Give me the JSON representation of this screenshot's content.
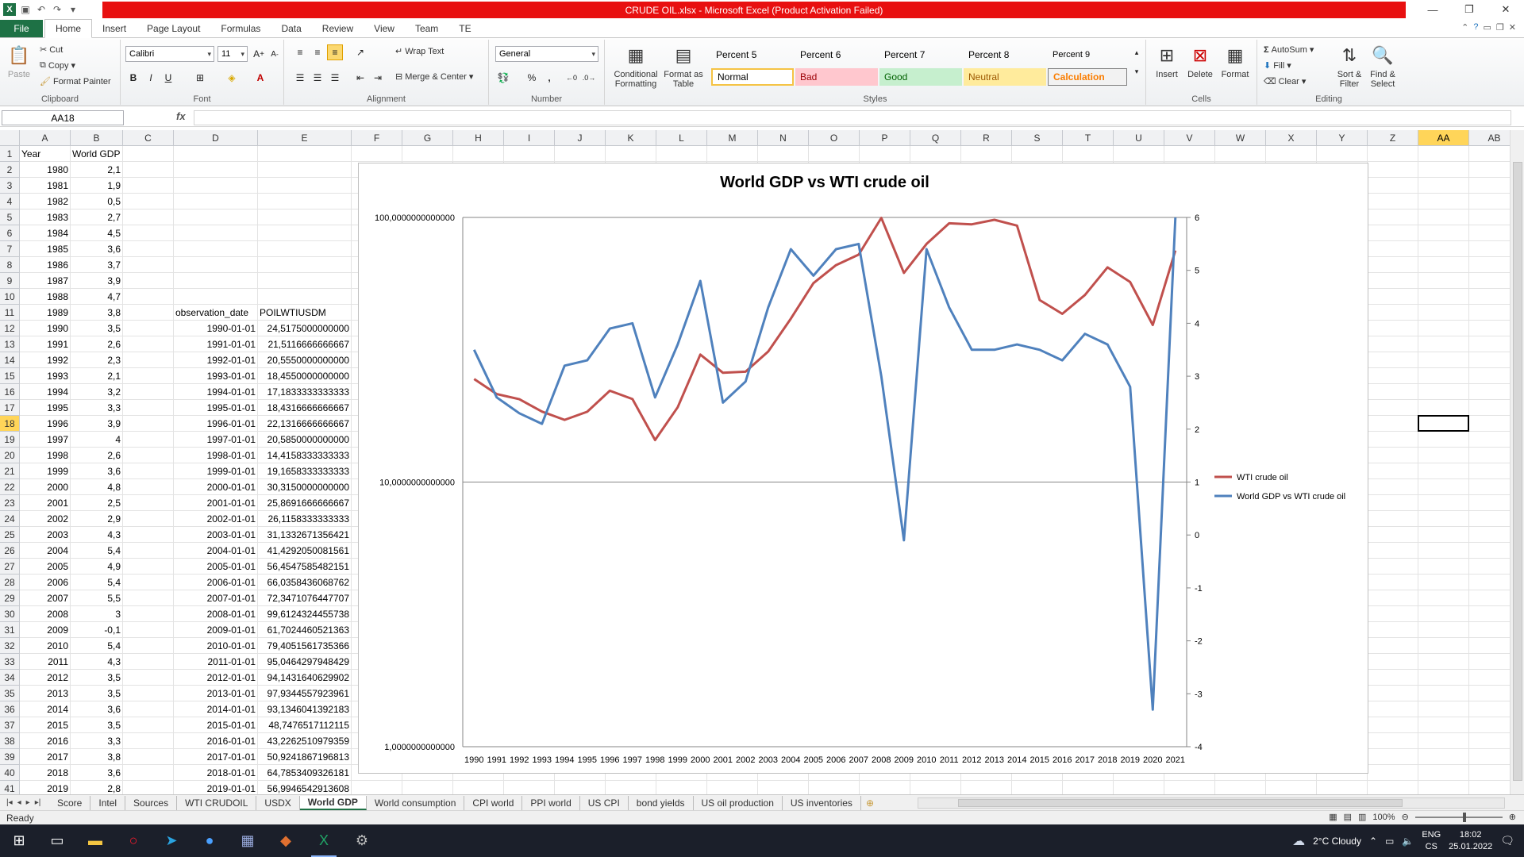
{
  "window": {
    "title": "CRUDE OIL.xlsx  -  Microsoft Excel (Product Activation Failed)",
    "controls": [
      "—",
      "❐",
      "✕"
    ]
  },
  "ribbon_tabs": [
    "File",
    "Home",
    "Insert",
    "Page Layout",
    "Formulas",
    "Data",
    "Review",
    "View",
    "Team",
    "TE"
  ],
  "ribbon": {
    "clipboard": {
      "paste": "Paste",
      "cut": "Cut",
      "copy": "Copy",
      "format_painter": "Format Painter",
      "label": "Clipboard"
    },
    "font": {
      "name": "Calibri",
      "size": "11",
      "bold": "B",
      "italic": "I",
      "underline": "U",
      "label": "Font"
    },
    "alignment": {
      "wrap_text": "Wrap Text",
      "merge_center": "Merge & Center",
      "label": "Alignment"
    },
    "number": {
      "format": "General",
      "percent": "%",
      "comma": ",",
      "label": "Number"
    },
    "styles": {
      "conditional_formatting": "Conditional Formatting",
      "format_as_table": "Format as Table",
      "cells_row1": [
        "Percent 5",
        "Percent 6",
        "Percent 7",
        "Percent 8",
        "Percent 9"
      ],
      "cells_row2": [
        "Normal",
        "Bad",
        "Good",
        "Neutral",
        "Calculation"
      ],
      "label": "Styles"
    },
    "cells": {
      "insert": "Insert",
      "delete": "Delete",
      "format": "Format",
      "label": "Cells"
    },
    "editing": {
      "autosum": "AutoSum",
      "fill": "Fill",
      "clear": "Clear",
      "sort_filter": "Sort & Filter",
      "find_select": "Find & Select",
      "label": "Editing"
    }
  },
  "formula_bar": {
    "name_box": "AA18",
    "fx": "fx",
    "formula": ""
  },
  "columns": [
    "A",
    "B",
    "C",
    "D",
    "E",
    "F",
    "G",
    "H",
    "I",
    "J",
    "K",
    "L",
    "M",
    "N",
    "O",
    "P",
    "Q",
    "R",
    "S",
    "T",
    "U",
    "V",
    "W",
    "X",
    "Y",
    "Z",
    "AA",
    "AB"
  ],
  "selected_column": "AA",
  "selected_row": 18,
  "rows": [
    "1",
    "2",
    "3",
    "4",
    "5",
    "6",
    "7",
    "8",
    "9",
    "10",
    "11",
    "12",
    "13",
    "14",
    "15",
    "16",
    "17",
    "18",
    "19",
    "20",
    "21",
    "22",
    "23",
    "24",
    "25",
    "26",
    "27",
    "28",
    "29",
    "30",
    "31",
    "32",
    "33",
    "34",
    "35",
    "36",
    "37",
    "38",
    "39",
    "40",
    "41"
  ],
  "sheet": {
    "header_year": "Year",
    "header_gdp": "World GDP",
    "header_obs": "observation_date",
    "header_poil": "POILWTIUSDM",
    "years": [
      "1980",
      "1981",
      "1982",
      "1983",
      "1984",
      "1985",
      "1986",
      "1987",
      "1988",
      "1989",
      "1990",
      "1991",
      "1992",
      "1993",
      "1994",
      "1995",
      "1996",
      "1997",
      "1998",
      "1999",
      "2000",
      "2001",
      "2002",
      "2003",
      "2004",
      "2005",
      "2006",
      "2007",
      "2008",
      "2009",
      "2010",
      "2011",
      "2012",
      "2013",
      "2014",
      "2015",
      "2016",
      "2017",
      "2018",
      "2019"
    ],
    "gdp": [
      "2,1",
      "1,9",
      "0,5",
      "2,7",
      "4,5",
      "3,6",
      "3,7",
      "3,9",
      "4,7",
      "3,8",
      "3,5",
      "2,6",
      "2,3",
      "2,1",
      "3,2",
      "3,3",
      "3,9",
      "4",
      "2,6",
      "3,6",
      "4,8",
      "2,5",
      "2,9",
      "4,3",
      "5,4",
      "4,9",
      "5,4",
      "5,5",
      "3",
      "-0,1",
      "5,4",
      "4,3",
      "3,5",
      "3,5",
      "3,6",
      "3,5",
      "3,3",
      "3,8",
      "3,6",
      "2,8"
    ],
    "obs_dates": [
      "1990-01-01",
      "1991-01-01",
      "1992-01-01",
      "1993-01-01",
      "1994-01-01",
      "1995-01-01",
      "1996-01-01",
      "1997-01-01",
      "1998-01-01",
      "1999-01-01",
      "2000-01-01",
      "2001-01-01",
      "2002-01-01",
      "2003-01-01",
      "2004-01-01",
      "2005-01-01",
      "2006-01-01",
      "2007-01-01",
      "2008-01-01",
      "2009-01-01",
      "2010-01-01",
      "2011-01-01",
      "2012-01-01",
      "2013-01-01",
      "2014-01-01",
      "2015-01-01",
      "2016-01-01",
      "2017-01-01",
      "2018-01-01",
      "2019-01-01"
    ],
    "poil": [
      "24,5175000000000",
      "21,5116666666667",
      "20,5550000000000",
      "18,4550000000000",
      "17,1833333333333",
      "18,4316666666667",
      "22,1316666666667",
      "20,5850000000000",
      "14,4158333333333",
      "19,1658333333333",
      "30,3150000000000",
      "25,8691666666667",
      "26,1158333333333",
      "31,1332671356421",
      "41,4292050081561",
      "56,4547585482151",
      "66,0358436068762",
      "72,3471076447707",
      "99,6124324455738",
      "61,7024460521363",
      "79,4051561735366",
      "95,0464297948429",
      "94,1431640629902",
      "97,9344557923961",
      "93,1346041392183",
      "48,7476517112115",
      "43,2262510979359",
      "50,9241867196813",
      "64,7853409326181",
      "56,9946542913608"
    ]
  },
  "chart_data": {
    "type": "line",
    "title": "World GDP vs WTI crude oil",
    "x": [
      "1990",
      "1991",
      "1992",
      "1993",
      "1994",
      "1995",
      "1996",
      "1997",
      "1998",
      "1999",
      "2000",
      "2001",
      "2002",
      "2003",
      "2004",
      "2005",
      "2006",
      "2007",
      "2008",
      "2009",
      "2010",
      "2011",
      "2012",
      "2013",
      "2014",
      "2015",
      "2016",
      "2017",
      "2018",
      "2019",
      "2020",
      "2021"
    ],
    "left_axis": {
      "scale": "log",
      "ylim": [
        1,
        100
      ],
      "ticks": [
        "1,0000000000000",
        "10,0000000000000",
        "100,0000000000000"
      ]
    },
    "right_axis": {
      "scale": "linear",
      "ylim": [
        -4,
        6
      ],
      "ticks": [
        "-4",
        "-3",
        "-2",
        "-1",
        "0",
        "1",
        "2",
        "3",
        "4",
        "5",
        "6"
      ]
    },
    "series": [
      {
        "name": "WTI crude oil",
        "axis": "left",
        "color": "#c0504d",
        "values": [
          24.52,
          21.51,
          20.56,
          18.46,
          17.18,
          18.43,
          22.13,
          20.59,
          14.42,
          19.17,
          30.32,
          25.87,
          26.12,
          31.13,
          41.43,
          56.45,
          66.04,
          72.35,
          99.61,
          61.7,
          79.41,
          95.05,
          94.14,
          97.93,
          93.13,
          48.75,
          43.23,
          50.92,
          64.79,
          56.99,
          39.2,
          75.0
        ]
      },
      {
        "name": "World GDP vs WTI crude oil",
        "axis": "right",
        "color": "#4f81bd",
        "values": [
          3.5,
          2.6,
          2.3,
          2.1,
          3.2,
          3.3,
          3.9,
          4.0,
          2.6,
          3.6,
          4.8,
          2.5,
          2.9,
          4.3,
          5.4,
          4.9,
          5.4,
          5.5,
          3.0,
          -0.1,
          5.4,
          4.3,
          3.5,
          3.5,
          3.6,
          3.5,
          3.3,
          3.8,
          3.6,
          2.8,
          -3.3,
          6.0
        ]
      }
    ],
    "legend_position": "right",
    "gridlines": "major-horizontal"
  },
  "sheet_tabs": [
    "Score",
    "Intel",
    "Sources",
    "WTI CRUDOIL",
    "USDX",
    "World GDP",
    "World consumption",
    "CPI world",
    "PPI world",
    "US CPI",
    "bond yields",
    "US oil production",
    "US inventories"
  ],
  "active_sheet": "World GDP",
  "status": {
    "ready": "Ready",
    "zoom": "100%"
  },
  "taskbar": {
    "weather": "2°C  Cloudy",
    "lang": "ENG",
    "lang2": "CS",
    "time": "18:02",
    "date": "25.01.2022"
  }
}
